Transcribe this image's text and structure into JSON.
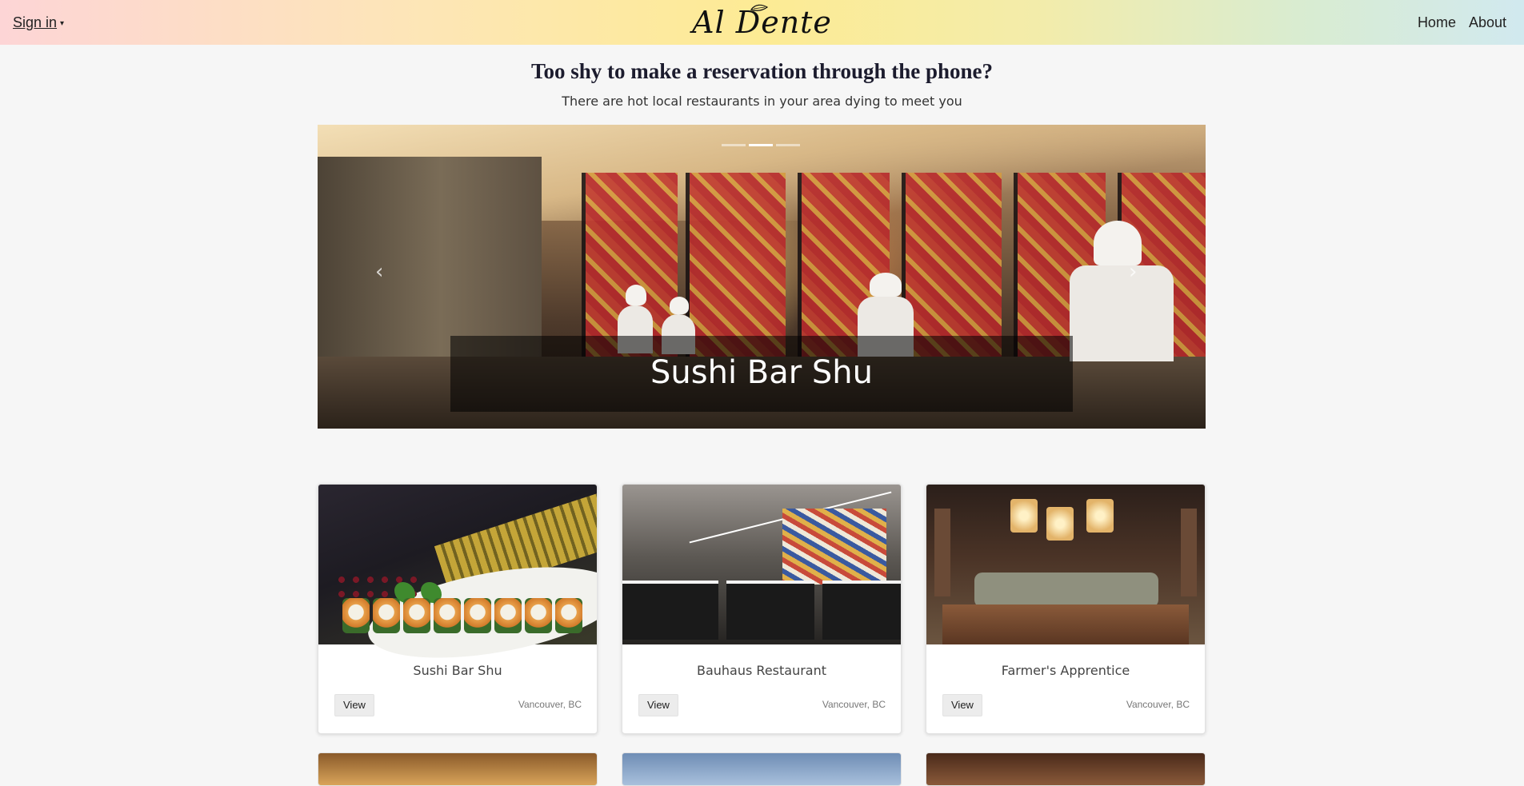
{
  "navbar": {
    "signin_label": "Sign in",
    "signin_caret": "▾",
    "brand": "Al Dente",
    "links": [
      "Home",
      "About"
    ]
  },
  "hero": {
    "headline": "Too shy to make a reservation through the phone?",
    "subline": "There are hot local restaurants in your area dying to meet you"
  },
  "carousel": {
    "caption": "Sushi Bar Shu",
    "prev_glyph": "‹",
    "next_glyph": "›",
    "slide_count": 3,
    "active_slide": 2
  },
  "restaurants": [
    {
      "name": "Sushi Bar Shu",
      "location": "Vancouver, BC",
      "button": "View"
    },
    {
      "name": "Bauhaus Restaurant",
      "location": "Vancouver, BC",
      "button": "View"
    },
    {
      "name": "Farmer's Apprentice",
      "location": "Vancouver, BC",
      "button": "View"
    }
  ],
  "colors": {
    "navbar_gradient": [
      "#fdd5d6",
      "#fdeb94",
      "#d1e9ef"
    ],
    "background": "#f6f6f6",
    "caption_overlay": "rgba(0,0,0,0.55)"
  }
}
